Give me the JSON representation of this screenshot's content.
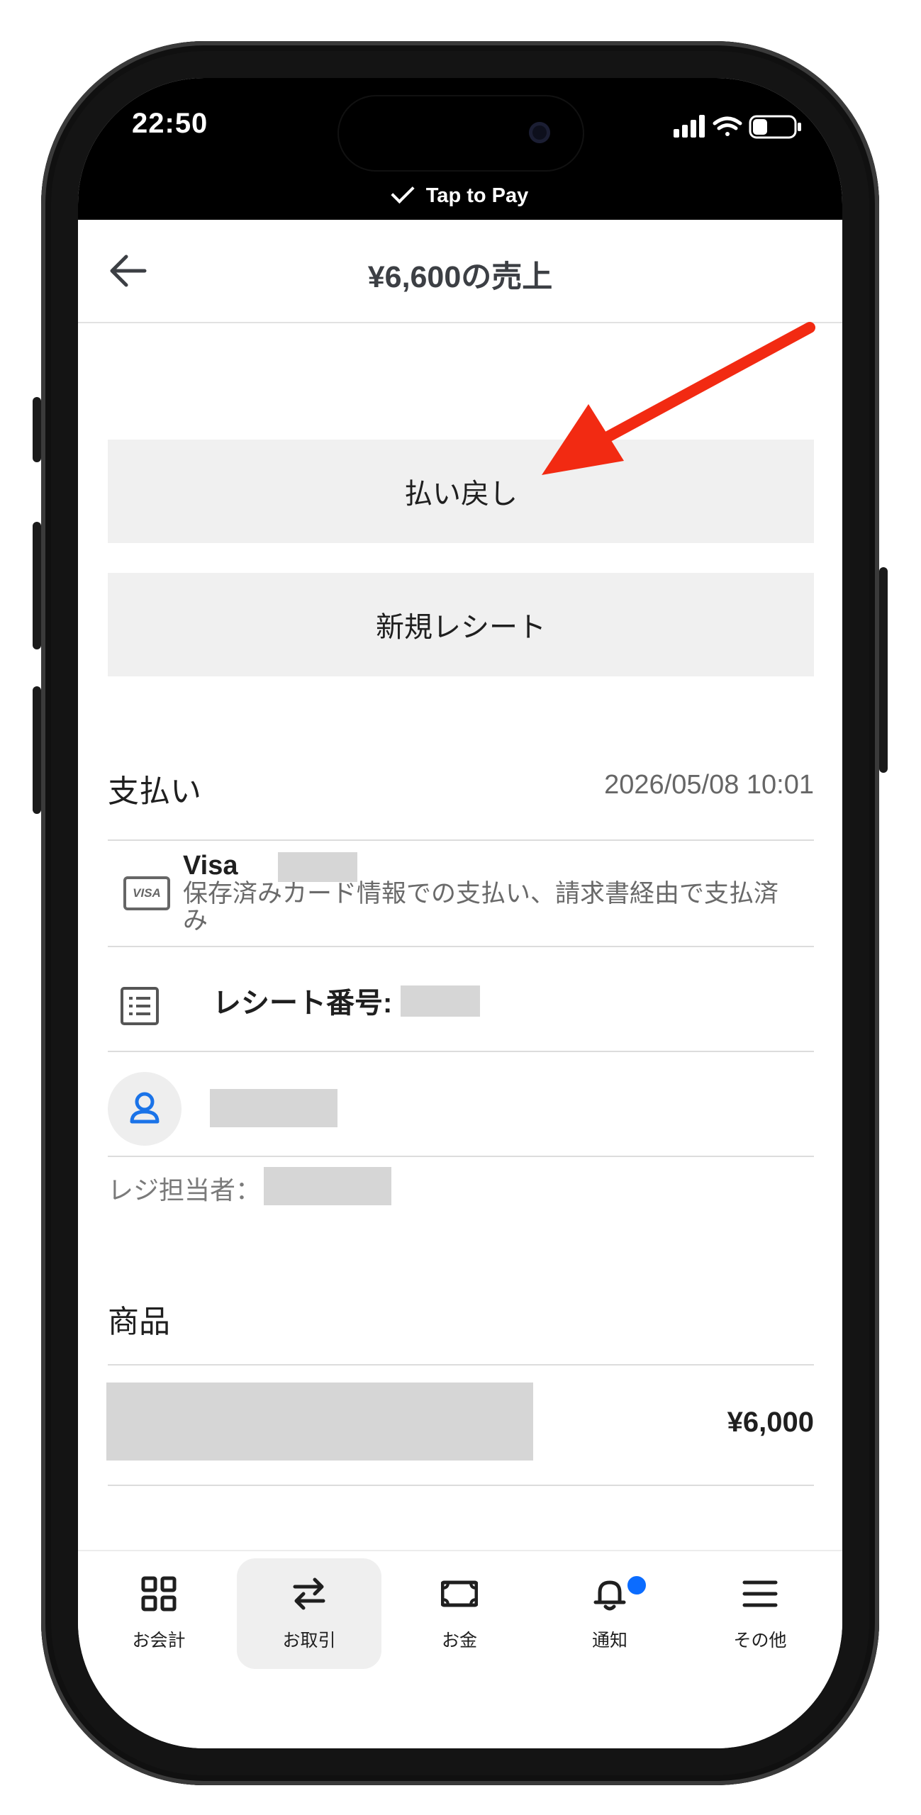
{
  "status_bar": {
    "time": "22:50",
    "tap_to_pay": "Tap to Pay"
  },
  "header": {
    "title": "¥6,600の売上"
  },
  "actions": {
    "refund": "払い戻し",
    "new_receipt": "新規レシート"
  },
  "payment": {
    "heading": "支払い",
    "date": "2026/05/08 10:01",
    "card_badge": "VISA",
    "card_brand": "Visa",
    "card_description": "保存済みカード情報での支払い、請求書経由で支払済み",
    "receipt_label": "レシート番号:",
    "cashier_label": "レジ担当者："
  },
  "items": {
    "heading": "商品",
    "rows": [
      {
        "price": "¥6,000"
      }
    ]
  },
  "tabbar": {
    "tabs": [
      {
        "label": "お会計"
      },
      {
        "label": "お取引"
      },
      {
        "label": "お金"
      },
      {
        "label": "通知"
      },
      {
        "label": "その他"
      }
    ]
  },
  "colors": {
    "accent": "#0b6cff",
    "annotation_arrow": "#f22a12",
    "button_bg": "#f0f0f0"
  }
}
